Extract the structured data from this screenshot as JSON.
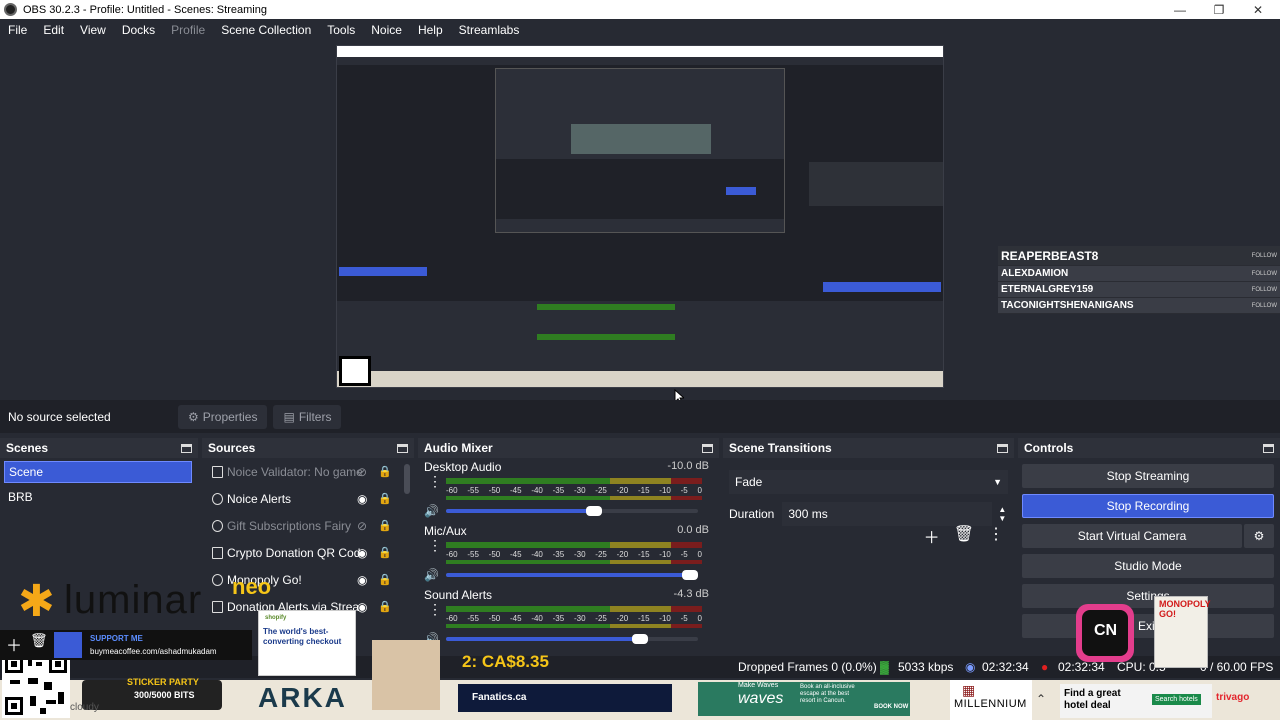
{
  "window": {
    "title": "OBS 30.2.3 - Profile: Untitled - Scenes: Streaming"
  },
  "menu": [
    "File",
    "Edit",
    "View",
    "Docks",
    "Profile",
    "Scene Collection",
    "Tools",
    "Noice",
    "Help",
    "Streamlabs"
  ],
  "menu_disabled": "Profile",
  "overlay_followers": {
    "follow_label": "FOLLOW",
    "names": [
      "REAPERBEAST8",
      "ALEXDAMION",
      "ETERNALGREY159",
      "TACONIGHTSHENANIGANS"
    ]
  },
  "source_bar": {
    "no_source": "No source selected",
    "properties": "Properties",
    "filters": "Filters"
  },
  "scenes": {
    "title": "Scenes",
    "items": [
      "Scene",
      "BRB"
    ],
    "selected": "Scene"
  },
  "sources": {
    "title": "Sources",
    "items": [
      {
        "label": "Noice Validator: No game",
        "visible": false
      },
      {
        "label": "Noice Alerts",
        "visible": true
      },
      {
        "label": "Gift Subscriptions Fairy",
        "visible": false
      },
      {
        "label": "Crypto Donation QR Code",
        "visible": true
      },
      {
        "label": "Monopoly Go!",
        "visible": true
      },
      {
        "label": "Donation Alerts via Strea",
        "visible": true
      }
    ]
  },
  "mixer": {
    "title": "Audio Mixer",
    "scale": [
      "-60",
      "-55",
      "-50",
      "-45",
      "-40",
      "-35",
      "-30",
      "-25",
      "-20",
      "-15",
      "-10",
      "-5",
      "0"
    ],
    "channels": [
      {
        "name": "Desktop Audio",
        "db": "-10.0 dB",
        "volume": 0.62
      },
      {
        "name": "Mic/Aux",
        "db": "0.0 dB",
        "volume": 1.0
      },
      {
        "name": "Sound Alerts",
        "db": "-4.3 dB",
        "volume": 0.8
      }
    ]
  },
  "transitions": {
    "title": "Scene Transitions",
    "selected": "Fade",
    "duration_label": "Duration",
    "duration_value": "300 ms"
  },
  "controls": {
    "title": "Controls",
    "stop_streaming": "Stop Streaming",
    "stop_recording": "Stop Recording",
    "start_virtual_camera": "Start Virtual Camera",
    "studio_mode": "Studio Mode",
    "settings": "Settings",
    "exit": "Exit"
  },
  "status": {
    "dropped_frames": "Dropped Frames 0 (0.0%)",
    "kbps": "5033 kbps",
    "stream_time": "02:32:34",
    "rec_time": "02:32:34",
    "cpu": "CPU: 0.5",
    "fps": "0 / 60.00 FPS"
  },
  "overlays": {
    "luminar": "luminar",
    "neo": "neo",
    "support_me": "SUPPORT ME",
    "support_url": "buymeacoffee.com/ashadmukadam",
    "shopify_brand": "shopify",
    "shopify_headline": "The world's best-converting checkout",
    "donation_amount": "2: CA$8.35",
    "sticker_party": "STICKER PARTY",
    "sticker_bits": "300/5000 BITS",
    "arka": "ARKA",
    "fanatics": "Fanatics.ca",
    "waves_make": "Make Waves",
    "waves": "waves",
    "waves_promo": "Book an all-inclusive escape at the best resort in Cancun.",
    "book_now": "BOOK NOW",
    "millennium": "MILLENNIUM",
    "hotel_deal": "Find a great hotel deal",
    "search_hotels": "Search hotels",
    "trivago": "trivago",
    "cloudy": "cloudy",
    "monopoly": "MONOPOLY GO!"
  }
}
